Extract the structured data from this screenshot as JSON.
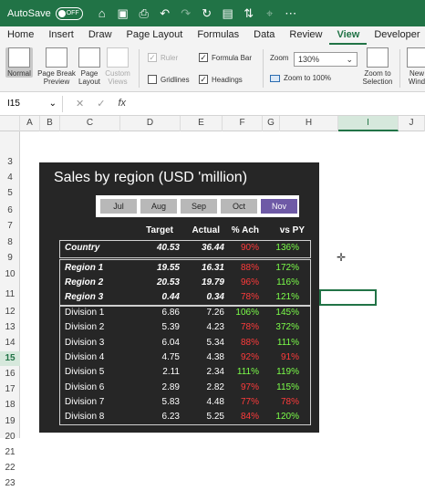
{
  "titlebar": {
    "autosave_label": "AutoSave",
    "autosave_state": "OFF",
    "icons": [
      "home-icon",
      "save-icon",
      "print-icon",
      "undo-icon",
      "redo-icon",
      "refresh-icon",
      "format-icon",
      "sort-icon",
      "filter-icon",
      "more-icon"
    ]
  },
  "tabs": [
    "Home",
    "Insert",
    "Draw",
    "Page Layout",
    "Formulas",
    "Data",
    "Review",
    "View",
    "Developer"
  ],
  "active_tab": "View",
  "ribbon": {
    "normal": "Normal",
    "page_break": "Page Break\nPreview",
    "page_layout": "Page\nLayout",
    "custom_views": "Custom\nViews",
    "ruler": "Ruler",
    "formula_bar": "Formula Bar",
    "gridlines": "Gridlines",
    "headings": "Headings",
    "zoom_label": "Zoom",
    "zoom_value": "130%",
    "zoom_100": "Zoom to 100%",
    "zoom_selection": "Zoom to\nSelection",
    "new_window": "New\nWind"
  },
  "formula_bar": {
    "name_box": "I15",
    "fx": "fx",
    "content": ""
  },
  "columns": [
    "A",
    "B",
    "C",
    "D",
    "E",
    "F",
    "G",
    "H",
    "I",
    "J"
  ],
  "selected_column": "I",
  "rows": [
    "3",
    "4",
    "5",
    "6",
    "7",
    "8",
    "9",
    "10",
    "11",
    "12",
    "13",
    "14",
    "15",
    "16",
    "17",
    "18",
    "19",
    "20",
    "21",
    "22",
    "23"
  ],
  "selected_row": "15",
  "dashboard": {
    "title": "Sales by region (USD 'million)",
    "months": [
      "Jul",
      "Aug",
      "Sep",
      "Oct",
      "Nov"
    ],
    "active_month": "Nov",
    "headers": [
      "Target",
      "Actual",
      "% Ach",
      "vs PY"
    ],
    "country": {
      "name": "Country",
      "target": "40.53",
      "actual": "36.44",
      "ach": "90%",
      "py": "136%"
    },
    "regions": [
      {
        "name": "Region 1",
        "target": "19.55",
        "actual": "16.31",
        "ach": "88%",
        "py": "172%"
      },
      {
        "name": "Region 2",
        "target": "20.53",
        "actual": "19.79",
        "ach": "96%",
        "py": "116%"
      },
      {
        "name": "Region 3",
        "target": "0.44",
        "actual": "0.34",
        "ach": "78%",
        "py": "121%"
      }
    ],
    "divisions": [
      {
        "name": "Division 1",
        "target": "6.86",
        "actual": "7.26",
        "ach": "106%",
        "py": "145%"
      },
      {
        "name": "Division 2",
        "target": "5.39",
        "actual": "4.23",
        "ach": "78%",
        "py": "372%"
      },
      {
        "name": "Division 3",
        "target": "6.04",
        "actual": "5.34",
        "ach": "88%",
        "py": "111%"
      },
      {
        "name": "Division 4",
        "target": "4.75",
        "actual": "4.38",
        "ach": "92%",
        "py": "91%"
      },
      {
        "name": "Division 5",
        "target": "2.11",
        "actual": "2.34",
        "ach": "111%",
        "py": "119%"
      },
      {
        "name": "Division 6",
        "target": "2.89",
        "actual": "2.82",
        "ach": "97%",
        "py": "115%"
      },
      {
        "name": "Division 7",
        "target": "5.83",
        "actual": "4.48",
        "ach": "77%",
        "py": "78%"
      },
      {
        "name": "Division 8",
        "target": "6.23",
        "actual": "5.25",
        "ach": "84%",
        "py": "120%"
      }
    ]
  }
}
